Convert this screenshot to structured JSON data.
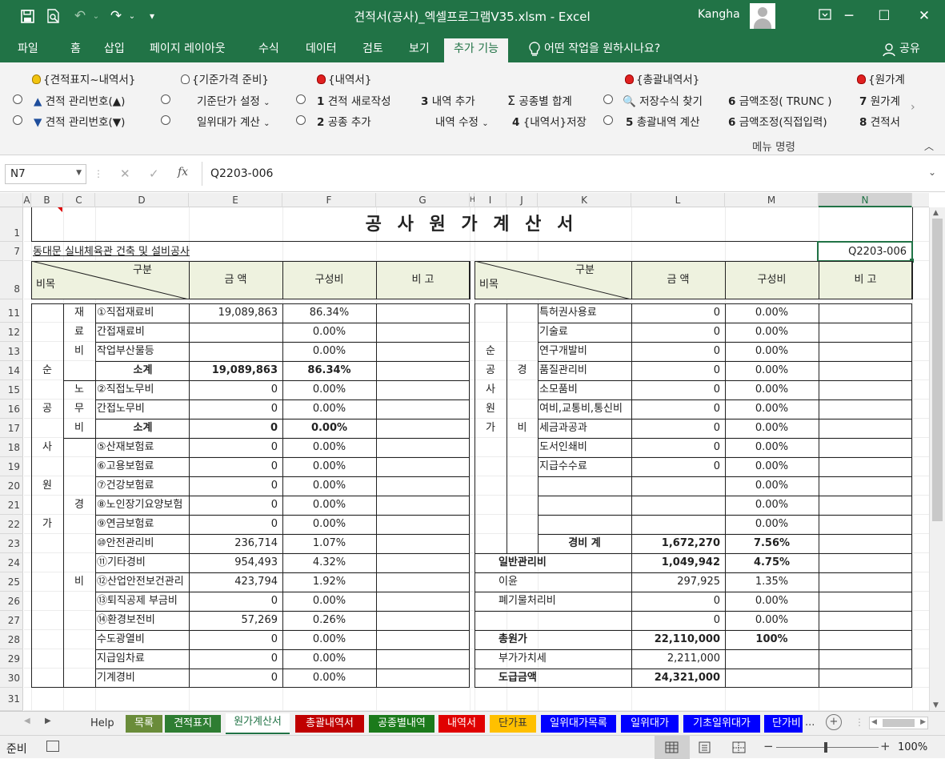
{
  "window": {
    "title": "견적서(공사)_엑셀프로그램V35.xlsm  -  Excel",
    "user": "Kangha",
    "min": "─",
    "restore": "☐",
    "close": "✕"
  },
  "tabs": [
    "파일",
    "홈",
    "삽입",
    "페이지 레이아웃",
    "수식",
    "데이터",
    "검토",
    "보기",
    "추가 기능"
  ],
  "tellme": "어떤 작업을 원하시나요?",
  "share": "공유",
  "ribbon": {
    "r1": [
      "{견적표지~내역서}",
      "{기준가격 준비}",
      "{내역서}",
      "{총괄내역서}",
      "{원가계"
    ],
    "est_up": "견적 관리번호(▲)",
    "est_down": "견적 관리번호(▼)",
    "basis_set": "기준단가 설정",
    "labor_calc": "일위대가 계산",
    "n1": "1",
    "new_est": "견적 새로작성",
    "n2": "2",
    "add_trade": "공종 추가",
    "n3": "3",
    "add_item": "내역 추가",
    "edit_item": "내역 수정",
    "n4": "4",
    "save_item": "{내역서}저장",
    "sum_trade": "공종별 합계",
    "find_formula": "저장수식 찾기",
    "n5": "5",
    "calc_total": "총괄내역 계산",
    "n6a": "6",
    "adj_trunc": "금액조정( TRUNC )",
    "n6b": "6",
    "adj_direct": "금액조정(직접입력)",
    "n7": "7",
    "cost_short": "원가계",
    "n8": "8",
    "est_short": "견적서",
    "group_label": "메뉴 명령"
  },
  "formula": {
    "namebox": "N7",
    "value": "Q2203-006",
    "fx": "fx",
    "cancel": "✕",
    "enter": "✓"
  },
  "columns": [
    "A",
    "B",
    "C",
    "D",
    "E",
    "F",
    "G",
    "H",
    "I",
    "J",
    "K",
    "L",
    "M",
    "N"
  ],
  "rows": [
    "1",
    "7",
    "8",
    "11",
    "12",
    "13",
    "14",
    "15",
    "16",
    "17",
    "18",
    "19",
    "20",
    "21",
    "22",
    "23",
    "24",
    "25",
    "26",
    "27",
    "28",
    "29",
    "30",
    "31"
  ],
  "sheet": {
    "title": "공 사 원 가 계 산 서",
    "project": "동대문 실내체육관 건축 및 설비공사",
    "code": "Q2203-006",
    "hdr": {
      "gubun": "구분",
      "bimok": "비목",
      "amount": "금      액",
      "ratio": "구성비",
      "note": "비      고"
    },
    "vert_left": [
      "순",
      "공",
      "사",
      "원",
      "가"
    ],
    "vert_material": [
      "재",
      "료",
      "비"
    ],
    "vert_labor": [
      "노",
      "무",
      "비"
    ],
    "vert_exp_left": [
      "경",
      "비"
    ],
    "vert_right": [
      "순",
      "공",
      "사",
      "원",
      "가"
    ],
    "vert_exp_right": [
      "경",
      "비"
    ],
    "left_rows": [
      {
        "label": "①직접재료비",
        "amount": "19,089,863",
        "ratio": "86.34%",
        "bold": false
      },
      {
        "label": "간접재료비",
        "amount": "",
        "ratio": "0.00%",
        "bold": false
      },
      {
        "label": "작업부산물등",
        "amount": "",
        "ratio": "0.00%",
        "bold": false
      },
      {
        "label": "소계",
        "amount": "19,089,863",
        "ratio": "86.34%",
        "bold": true
      },
      {
        "label": "②직접노무비",
        "amount": "0",
        "ratio": "0.00%",
        "bold": false
      },
      {
        "label": "간접노무비",
        "amount": "0",
        "ratio": "0.00%",
        "bold": false
      },
      {
        "label": "소계",
        "amount": "0",
        "ratio": "0.00%",
        "bold": true
      },
      {
        "label": "⑤산재보험료",
        "amount": "0",
        "ratio": "0.00%",
        "bold": false
      },
      {
        "label": "⑥고용보험료",
        "amount": "0",
        "ratio": "0.00%",
        "bold": false
      },
      {
        "label": "⑦건강보험료",
        "amount": "0",
        "ratio": "0.00%",
        "bold": false
      },
      {
        "label": "⑧노인장기요양보험",
        "amount": "0",
        "ratio": "0.00%",
        "bold": false
      },
      {
        "label": "⑨연금보험료",
        "amount": "0",
        "ratio": "0.00%",
        "bold": false
      },
      {
        "label": "⑩안전관리비",
        "amount": "236,714",
        "ratio": "1.07%",
        "bold": false
      },
      {
        "label": "⑪기타경비",
        "amount": "954,493",
        "ratio": "4.32%",
        "bold": false
      },
      {
        "label": "⑫산업안전보건관리",
        "amount": "423,794",
        "ratio": "1.92%",
        "bold": false
      },
      {
        "label": "⑬퇴직공제 부금비",
        "amount": "0",
        "ratio": "0.00%",
        "bold": false
      },
      {
        "label": "⑭환경보전비",
        "amount": "57,269",
        "ratio": "0.26%",
        "bold": false
      },
      {
        "label": "수도광열비",
        "amount": "0",
        "ratio": "0.00%",
        "bold": false
      },
      {
        "label": "지급임차료",
        "amount": "0",
        "ratio": "0.00%",
        "bold": false
      },
      {
        "label": "기계경비",
        "amount": "0",
        "ratio": "0.00%",
        "bold": false
      }
    ],
    "right_rows": [
      {
        "label": "특허권사용료",
        "amount": "0",
        "ratio": "0.00%"
      },
      {
        "label": "기술료",
        "amount": "0",
        "ratio": "0.00%"
      },
      {
        "label": "연구개발비",
        "amount": "0",
        "ratio": "0.00%"
      },
      {
        "label": "품질관리비",
        "amount": "0",
        "ratio": "0.00%"
      },
      {
        "label": "소모품비",
        "amount": "0",
        "ratio": "0.00%"
      },
      {
        "label": "여비,교통비,통신비",
        "amount": "0",
        "ratio": "0.00%"
      },
      {
        "label": "세금과공과",
        "amount": "0",
        "ratio": "0.00%"
      },
      {
        "label": "도서인쇄비",
        "amount": "0",
        "ratio": "0.00%"
      },
      {
        "label": "지급수수료",
        "amount": "0",
        "ratio": "0.00%"
      },
      {
        "label": "",
        "amount": "",
        "ratio": "0.00%"
      },
      {
        "label": "",
        "amount": "",
        "ratio": "0.00%"
      },
      {
        "label": "",
        "amount": "",
        "ratio": "0.00%"
      }
    ],
    "exp_total": {
      "label": "경비  계",
      "amount": "1,672,270",
      "ratio": "7.56%"
    },
    "right_bottom": [
      {
        "label": "일반관리비",
        "amount": "1,049,942",
        "ratio": "4.75%",
        "bold": true
      },
      {
        "label": "이윤",
        "amount": "297,925",
        "ratio": "1.35%",
        "bold": false
      },
      {
        "label": "폐기물처리비",
        "amount": "0",
        "ratio": "0.00%",
        "bold": false
      },
      {
        "label": "",
        "amount": "0",
        "ratio": "0.00%",
        "bold": false
      },
      {
        "label": "총원가",
        "amount": "22,110,000",
        "ratio": "100%",
        "bold": true
      },
      {
        "label": "부가가치세",
        "amount": "2,211,000",
        "ratio": "",
        "bold": false
      },
      {
        "label": "도급금액",
        "amount": "24,321,000",
        "ratio": "",
        "bold": true
      }
    ]
  },
  "sheet_tabs": [
    {
      "label": "Help",
      "bg": "#f0f0f0",
      "fg": "#333"
    },
    {
      "label": "목록",
      "bg": "#6a8c3a",
      "fg": "#fff"
    },
    {
      "label": "견적표지",
      "bg": "#2e7d32",
      "fg": "#fff"
    },
    {
      "label": "원가계산서",
      "bg": "#ffffff",
      "fg": "#217346"
    },
    {
      "label": "총괄내역서",
      "bg": "#c00000",
      "fg": "#fff"
    },
    {
      "label": "공종별내역",
      "bg": "#1b7a1b",
      "fg": "#fff"
    },
    {
      "label": "내역서",
      "bg": "#e00000",
      "fg": "#fff"
    },
    {
      "label": "단가표",
      "bg": "#ffc000",
      "fg": "#333"
    },
    {
      "label": "일위대가목록",
      "bg": "#0000ff",
      "fg": "#fff"
    },
    {
      "label": "일위대가",
      "bg": "#0000ff",
      "fg": "#fff"
    },
    {
      "label": "기초일위대가",
      "bg": "#0000ff",
      "fg": "#fff"
    },
    {
      "label": "단가비",
      "bg": "#0000ff",
      "fg": "#fff"
    }
  ],
  "sheet_more": "...",
  "status": {
    "ready": "준비",
    "zoom": "100%",
    "minus": "−",
    "plus": "+"
  }
}
